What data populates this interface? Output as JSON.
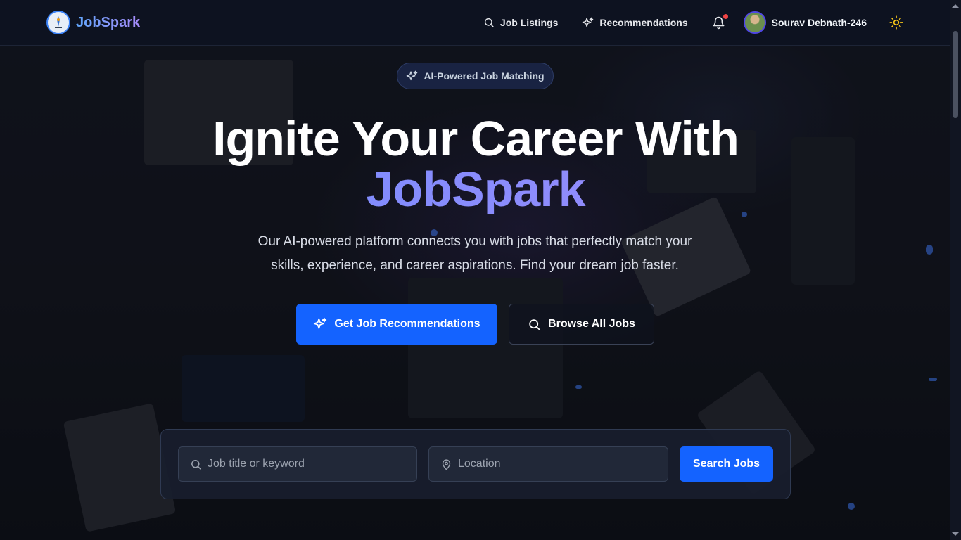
{
  "nav": {
    "brand": "JobSpark",
    "links": [
      {
        "label": "Job Listings",
        "icon": "search-icon"
      },
      {
        "label": "Recommendations",
        "icon": "sparkles-icon"
      }
    ],
    "notifications_icon": "bell-icon",
    "user_name": "Sourav Debnath-246",
    "theme_icon": "sun-icon"
  },
  "hero": {
    "badge": "AI-Powered Job Matching",
    "title_line1": "Ignite Your Career With",
    "title_line2": "JobSpark",
    "subtitle_line1": "Our AI-powered platform connects you with jobs that perfectly match your",
    "subtitle_line2": "skills, experience, and career aspirations. Find your dream job faster.",
    "primary_button": "Get Job Recommendations",
    "secondary_button": "Browse All Jobs"
  },
  "search": {
    "keyword_placeholder": "Job title or keyword",
    "keyword_value": "",
    "location_placeholder": "Location",
    "location_value": "",
    "button": "Search Jobs"
  },
  "colors": {
    "primary": "#1463ff",
    "accent_gradient_start": "#6b8cff",
    "accent_gradient_end": "#a78bfa",
    "background": "#0b0f1a",
    "notification_dot": "#ef4444",
    "theme_icon": "#f5c518"
  }
}
